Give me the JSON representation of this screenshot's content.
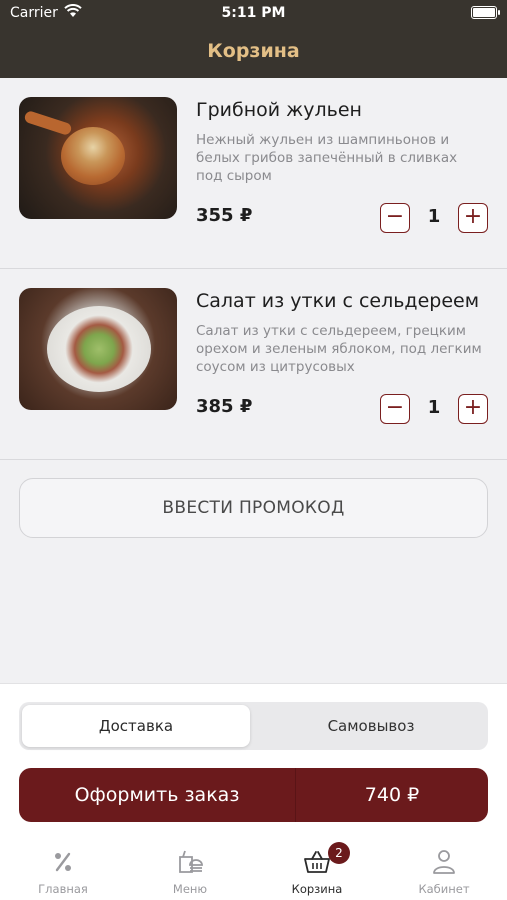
{
  "status_bar": {
    "carrier": "Carrier",
    "time": "5:11 PM"
  },
  "header": {
    "title": "Корзина"
  },
  "cart": {
    "items": [
      {
        "name": "Грибной жульен",
        "description": "Нежный жульен из шампиньонов и белых грибов запечённый в сливках под сыром",
        "price": "355 ₽",
        "quantity": "1",
        "minus": "−",
        "plus": "+"
      },
      {
        "name": "Салат из утки с сельдереем",
        "description": "Салат из утки с сельдереем, грецким орехом и зеленым яблоком, под легким соусом из цитрусовых",
        "price": "385 ₽",
        "quantity": "1",
        "minus": "−",
        "plus": "+"
      }
    ]
  },
  "promo": {
    "label": "ВВЕСТИ ПРОМОКОД"
  },
  "delivery_toggle": {
    "options": [
      "Доставка",
      "Самовывоз"
    ],
    "selected": "Доставка"
  },
  "order_button": {
    "label": "Оформить заказ",
    "total": "740 ₽"
  },
  "tabbar": {
    "tabs": [
      {
        "label": "Главная",
        "icon": "percent-icon"
      },
      {
        "label": "Меню",
        "icon": "menu-food-icon"
      },
      {
        "label": "Корзина",
        "icon": "basket-icon",
        "badge": "2",
        "active": true
      },
      {
        "label": "Кабинет",
        "icon": "user-icon"
      }
    ]
  },
  "colors": {
    "accent": "#6b1a1c",
    "header_bg": "#38342e",
    "title": "#e3bf86"
  }
}
